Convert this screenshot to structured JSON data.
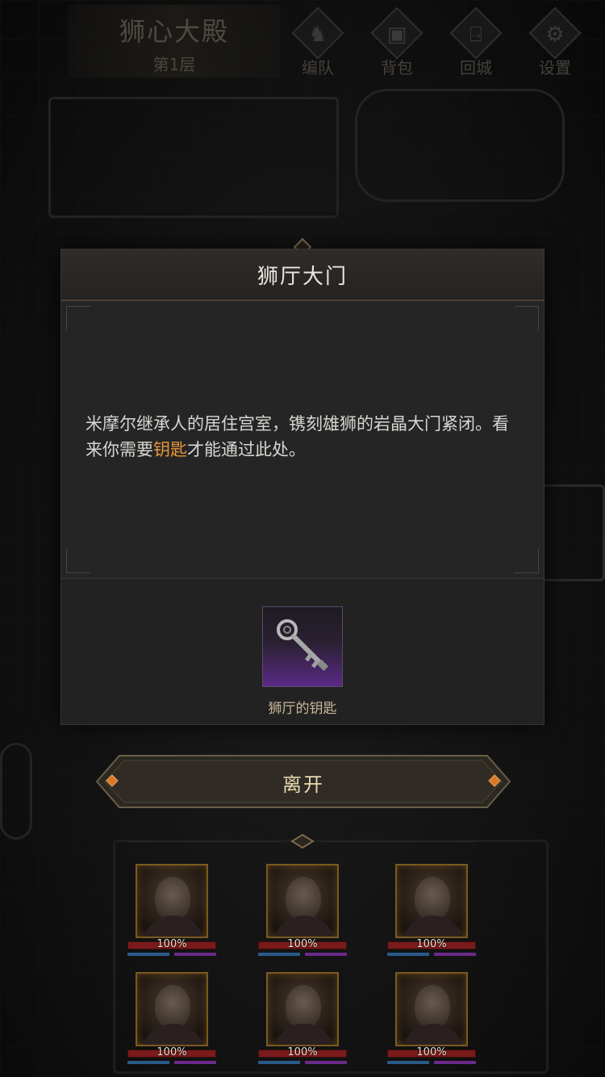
{
  "header": {
    "dungeon_name": "狮心大殿",
    "floor": "第1层"
  },
  "menu": [
    {
      "label": "编队",
      "icon": "helmet-icon"
    },
    {
      "label": "背包",
      "icon": "backpack-icon"
    },
    {
      "label": "回城",
      "icon": "door-exit-icon"
    },
    {
      "label": "设置",
      "icon": "gear-icon"
    }
  ],
  "dialog": {
    "title": "狮厅大门",
    "description_part1": "米摩尔继承人的居住宫室，镌刻雄狮的岩晶大门紧闭。看来你需要",
    "description_highlight": "钥匙",
    "description_part2": "才能通过此处。",
    "highlight_color": "#e8953a",
    "item": {
      "name": "狮厅的钥匙",
      "icon": "key-icon",
      "rarity_color": "#5a2a86"
    }
  },
  "leave_button": "离开",
  "party": [
    {
      "hp": "100%"
    },
    {
      "hp": "100%"
    },
    {
      "hp": "100%"
    },
    {
      "hp": "100%"
    },
    {
      "hp": "100%"
    },
    {
      "hp": "100%"
    }
  ]
}
